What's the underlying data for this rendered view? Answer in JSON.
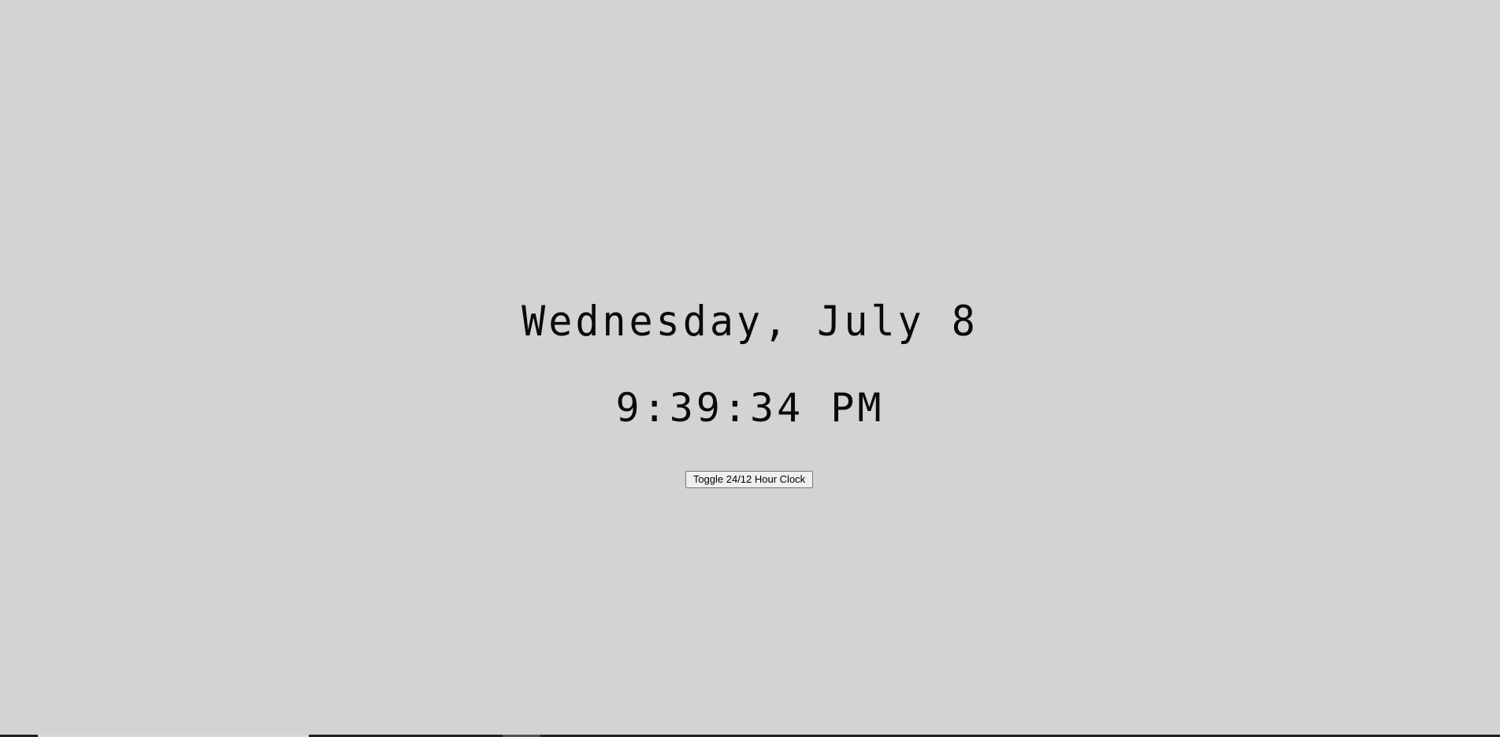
{
  "clock": {
    "date_text": "Wednesday, July 8",
    "time_text": "9:39:34 PM"
  },
  "controls": {
    "toggle_label": "Toggle 24/12 Hour Clock"
  },
  "colors": {
    "background": "#d3d3d3",
    "text": "#0a0a0a"
  }
}
